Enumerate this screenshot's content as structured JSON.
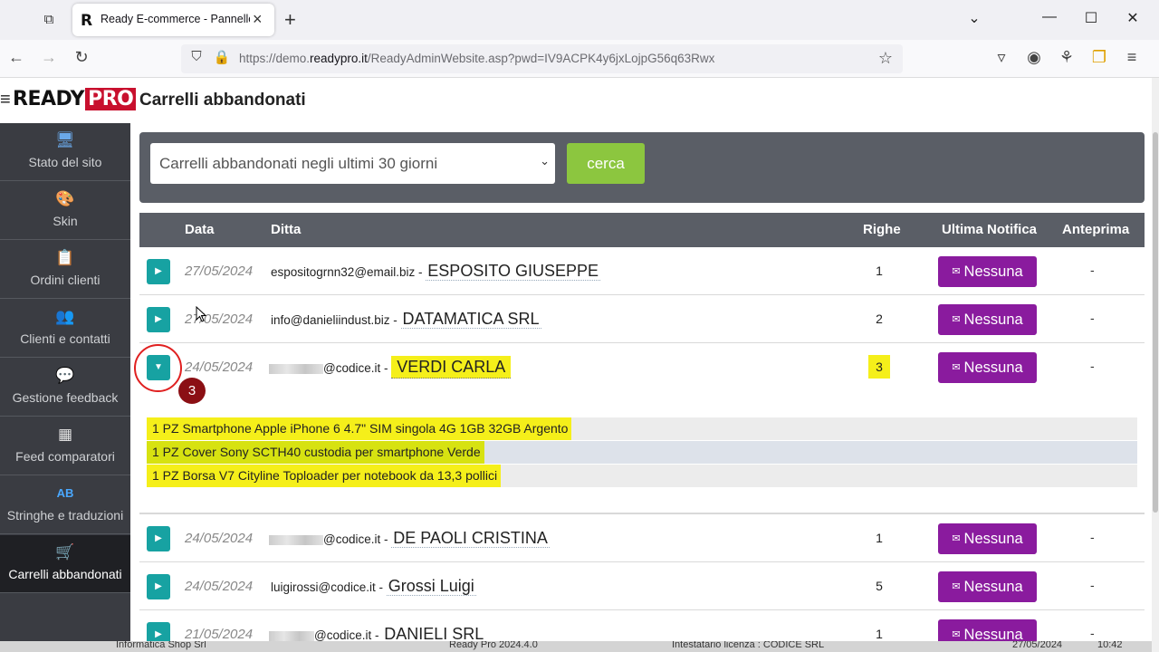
{
  "browser": {
    "tab_title": "Ready E-commerce - Pannello amministrazione",
    "url_pre": "https://demo.",
    "url_host": "readypro.it",
    "url_post": "/ReadyAdminWebsite.asp?pwd=IV9ACPK4y6jxLojpG56q63Rwx"
  },
  "app": {
    "logo_ready": "READY",
    "logo_pro": "PRO",
    "page_title": "Carrelli abbandonati"
  },
  "sidebar": {
    "items": [
      {
        "label": "Stato del sito",
        "icon": "🖥"
      },
      {
        "label": "Skin",
        "icon": "🎨"
      },
      {
        "label": "Ordini clienti",
        "icon": "📋"
      },
      {
        "label": "Clienti e contatti",
        "icon": "👥"
      },
      {
        "label": "Gestione feedback",
        "icon": "💬"
      },
      {
        "label": "Feed comparatori",
        "icon": "▦"
      },
      {
        "label": "Stringhe e traduzioni",
        "icon": "AB"
      },
      {
        "label": "Carrelli abbandonati",
        "icon": "🛒"
      }
    ]
  },
  "filter": {
    "selected": "Carrelli abbandonati negli ultimi 30 giorni",
    "search_label": "cerca"
  },
  "table": {
    "headers": {
      "data": "Data",
      "ditta": "Ditta",
      "righe": "Righe",
      "notifica": "Ultima Notifica",
      "anteprima": "Anteprima"
    },
    "rows": [
      {
        "date": "27/05/2024",
        "email": "espositogrnn32@email.biz",
        "company": "ESPOSITO GIUSEPPE",
        "righe": "1",
        "notifica": "Nessuna",
        "anteprima": "-"
      },
      {
        "date": "27/05/2024",
        "email": "info@danieliindust.biz",
        "company": "DATAMATICA SRL",
        "righe": "2",
        "notifica": "Nessuna",
        "anteprima": "-"
      },
      {
        "date": "24/05/2024",
        "email": "@codice.it",
        "company": "VERDI CARLA",
        "righe": "3",
        "notifica": "Nessuna",
        "anteprima": "-"
      },
      {
        "date": "24/05/2024",
        "email": "@codice.it",
        "company": "DE PAOLI CRISTINA",
        "righe": "1",
        "notifica": "Nessuna",
        "anteprima": "-"
      },
      {
        "date": "24/05/2024",
        "email": "luigirossi@codice.it",
        "company": "Grossi Luigi",
        "righe": "5",
        "notifica": "Nessuna",
        "anteprima": "-"
      },
      {
        "date": "21/05/2024",
        "email": "@codice.it",
        "company": "DANIELI SRL",
        "righe": "1",
        "notifica": "Nessuna",
        "anteprima": "-"
      }
    ],
    "expanded_details": [
      "1 PZ Smartphone Apple iPhone 6 4.7\" SIM singola 4G 1GB 32GB Argento",
      "1 PZ Cover Sony SCTH40 custodia per smartphone Verde",
      "1 PZ Borsa V7 Cityline Toploader per notebook da 13,3 pollici"
    ]
  },
  "annotation": {
    "step": "3"
  },
  "footer": {
    "a": "Informatica Shop Srl",
    "b": "Ready Pro 2024.4.0",
    "c": "Intestatario licenza : CODICE SRL",
    "d": "27/05/2024",
    "e": "10:42"
  },
  "colors": {
    "accent_teal": "#17a2a2",
    "notify_purple": "#8a1b9e",
    "search_green": "#8cc63f",
    "highlight_yellow": "#f5ef1a"
  }
}
